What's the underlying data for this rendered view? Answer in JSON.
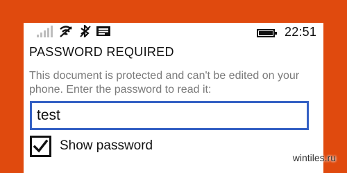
{
  "status_bar": {
    "time": "22:51",
    "icons": [
      "signal-icon",
      "wifi-icon",
      "bluetooth-icon",
      "message-icon",
      "battery-icon"
    ]
  },
  "dialog": {
    "title": "PASSWORD REQUIRED",
    "message": "This document is protected and can't be edited on your phone. Enter the password to read it:",
    "password_value": "test",
    "show_password_label": "Show password",
    "show_password_checked": true
  },
  "watermark": "wintiles.ru",
  "colors": {
    "background": "#e04a0e",
    "screen": "#ffffff",
    "input_border": "#3561c4",
    "message_text": "#7a7a7a"
  }
}
